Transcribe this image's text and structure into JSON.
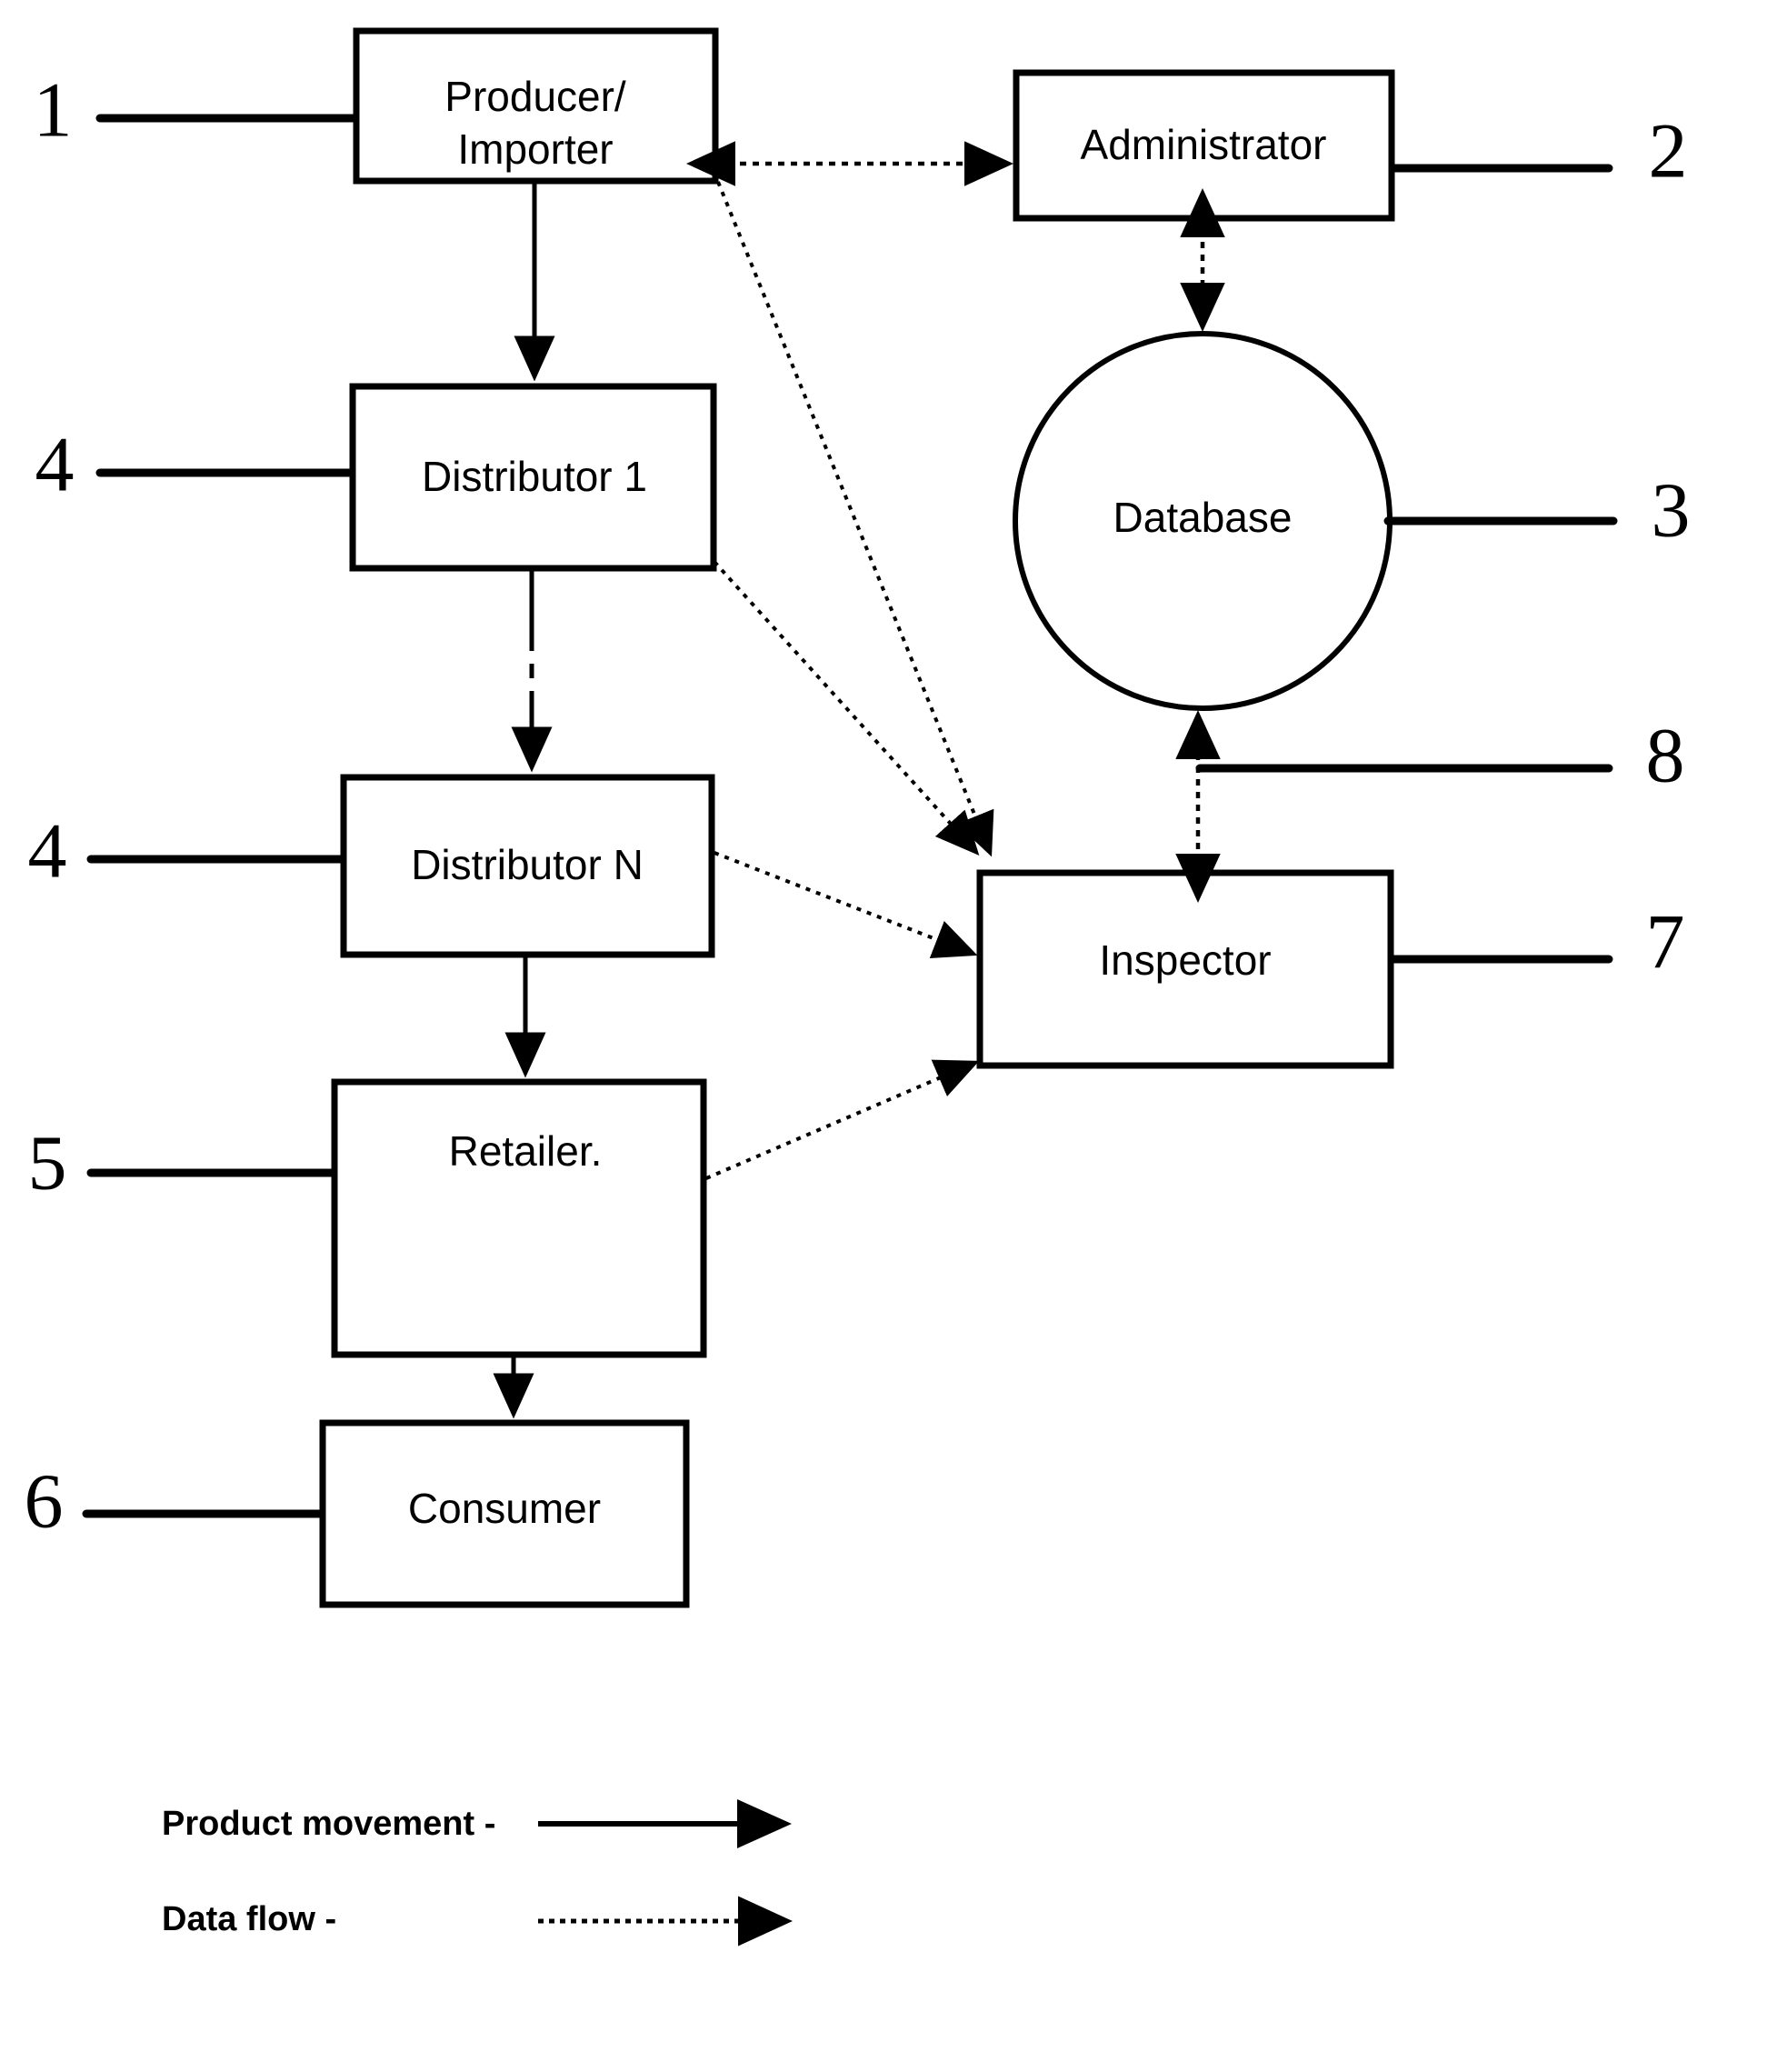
{
  "figure": {
    "type": "block-flow-diagram",
    "nodes": [
      {
        "id": "producer",
        "label": "Producer/\nImporter",
        "line1": "Producer/",
        "line2": "Importer",
        "shape": "rect",
        "ref": "1"
      },
      {
        "id": "administrator",
        "label": "Administrator",
        "shape": "rect",
        "ref": "2"
      },
      {
        "id": "database",
        "label": "Database",
        "shape": "circle",
        "ref": "3"
      },
      {
        "id": "distributor1",
        "label": "Distributor 1",
        "shape": "rect",
        "ref": "4"
      },
      {
        "id": "distributorN",
        "label": "Distributor N",
        "shape": "rect",
        "ref": "4"
      },
      {
        "id": "retailer",
        "label": "Retailer.",
        "shape": "rect",
        "ref": "5"
      },
      {
        "id": "consumer",
        "label": "Consumer",
        "shape": "rect",
        "ref": "6"
      },
      {
        "id": "inspector",
        "label": "Inspector",
        "shape": "rect",
        "ref": "7"
      }
    ],
    "reference_numerals": [
      {
        "num": "1",
        "points_to": "producer"
      },
      {
        "num": "2",
        "points_to": "administrator"
      },
      {
        "num": "3",
        "points_to": "database"
      },
      {
        "num": "4",
        "points_to": "distributor1"
      },
      {
        "num": "4",
        "points_to": "distributorN"
      },
      {
        "num": "5",
        "points_to": "retailer"
      },
      {
        "num": "6",
        "points_to": "consumer"
      },
      {
        "num": "7",
        "points_to": "inspector"
      },
      {
        "num": "8",
        "points_to": "database-inspector-data-link"
      }
    ],
    "connections": [
      {
        "from": "producer",
        "to": "distributor1",
        "kind": "product movement",
        "style": "solid"
      },
      {
        "from": "distributor1",
        "to": "distributorN",
        "kind": "product movement",
        "style": "dashed-continuation"
      },
      {
        "from": "distributorN",
        "to": "retailer",
        "kind": "product movement",
        "style": "solid"
      },
      {
        "from": "retailer",
        "to": "consumer",
        "kind": "product movement",
        "style": "solid"
      },
      {
        "from": "producer",
        "to": "administrator",
        "kind": "data flow",
        "style": "dotted",
        "bidirectional": true
      },
      {
        "from": "administrator",
        "to": "database",
        "kind": "data flow",
        "style": "dotted",
        "bidirectional": true
      },
      {
        "from": "database",
        "to": "inspector",
        "kind": "data flow",
        "style": "dotted",
        "bidirectional": true
      },
      {
        "from": "producer",
        "to": "inspector",
        "kind": "data flow",
        "style": "dotted",
        "bidirectional": true
      },
      {
        "from": "distributor1",
        "to": "inspector",
        "kind": "data flow",
        "style": "dotted"
      },
      {
        "from": "distributorN",
        "to": "inspector",
        "kind": "data flow",
        "style": "dotted"
      },
      {
        "from": "retailer",
        "to": "inspector",
        "kind": "data flow",
        "style": "dotted"
      }
    ]
  },
  "legend": {
    "items": [
      {
        "label": "Product movement -",
        "style": "solid-arrow"
      },
      {
        "label": "Data flow -",
        "style": "dotted-arrow"
      }
    ]
  },
  "colors": {
    "ink": "#000000",
    "paper": "#ffffff"
  }
}
